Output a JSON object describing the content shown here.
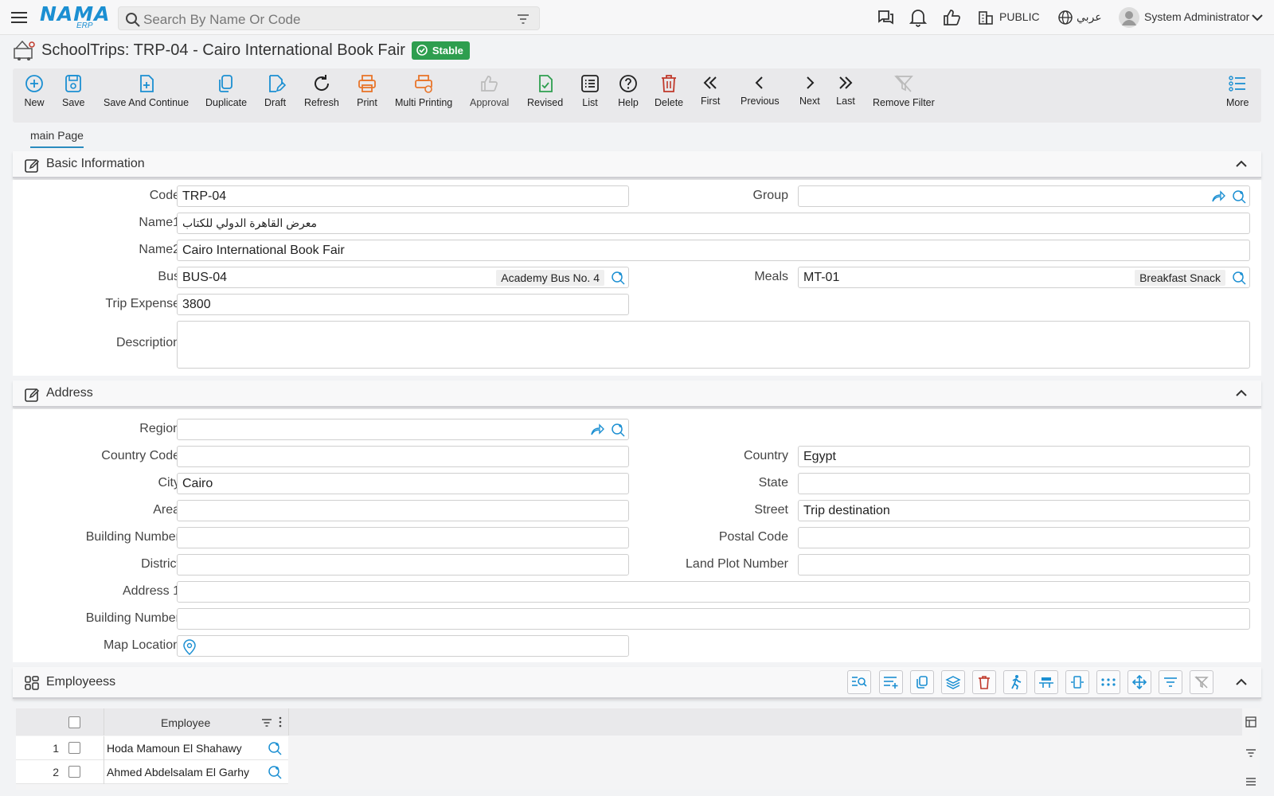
{
  "topbar": {
    "logo_main": "NAMA",
    "logo_sub": "ERP",
    "search_placeholder": "Search By Name Or Code",
    "public_label": "PUBLIC",
    "lang_label": "عربي",
    "user_name": "System Administrator"
  },
  "page": {
    "title": "SchoolTrips: TRP-04 - Cairo International Book Fair",
    "status": "Stable"
  },
  "toolbar": {
    "new": "New",
    "save": "Save",
    "save_continue": "Save And Continue",
    "duplicate": "Duplicate",
    "draft": "Draft",
    "refresh": "Refresh",
    "print": "Print",
    "multi_printing": "Multi Printing",
    "approval": "Approval",
    "revised": "Revised",
    "list": "List",
    "help": "Help",
    "delete": "Delete",
    "first": "First",
    "previous": "Previous",
    "next": "Next",
    "last": "Last",
    "remove_filter": "Remove Filter",
    "more": "More"
  },
  "tabs": {
    "main": "main Page"
  },
  "basic": {
    "title": "Basic Information",
    "code_label": "Code",
    "code": "TRP-04",
    "group_label": "Group",
    "group": "",
    "name1_label": "Name1",
    "name1": "معرض القاهرة الدولي للكتاب",
    "name2_label": "Name2",
    "name2": "Cairo International Book Fair",
    "bus_label": "Bus",
    "bus_code": "BUS-04",
    "bus_name": "Academy Bus No. 4",
    "meals_label": "Meals",
    "meals_code": "MT-01",
    "meals_name": "Breakfast Snack",
    "expense_label": "Trip Expense",
    "expense": "3800",
    "description_label": "Description",
    "description": ""
  },
  "address": {
    "title": "Address",
    "region_label": "Region",
    "region": "",
    "country_code_label": "Country Code",
    "country_code": "",
    "country_label": "Country",
    "country": "Egypt",
    "city_label": "City",
    "city": "Cairo",
    "state_label": "State",
    "state": "",
    "area_label": "Area",
    "area": "",
    "street_label": "Street",
    "street": "Trip destination",
    "building_label": "Building Number",
    "building": "",
    "postal_label": "Postal Code",
    "postal": "",
    "district_label": "District",
    "district": "",
    "land_plot_label": "Land Plot Number",
    "land_plot": "",
    "address1_label": "Address 1",
    "address1": "",
    "building2_label": "Building Number",
    "building2": "",
    "map_label": "Map Location",
    "map": ""
  },
  "employees": {
    "title": "Employeess",
    "column_employee": "Employee",
    "rows": [
      {
        "num": "1",
        "name": "Hoda Mamoun El Shahawy"
      },
      {
        "num": "2",
        "name": "Ahmed Abdelsalam El Garhy"
      }
    ]
  },
  "colors": {
    "accent": "#1b8fd2",
    "stable_badge": "#2e9e4f",
    "delete_red": "#c0392b",
    "print_orange": "#e8752a"
  }
}
